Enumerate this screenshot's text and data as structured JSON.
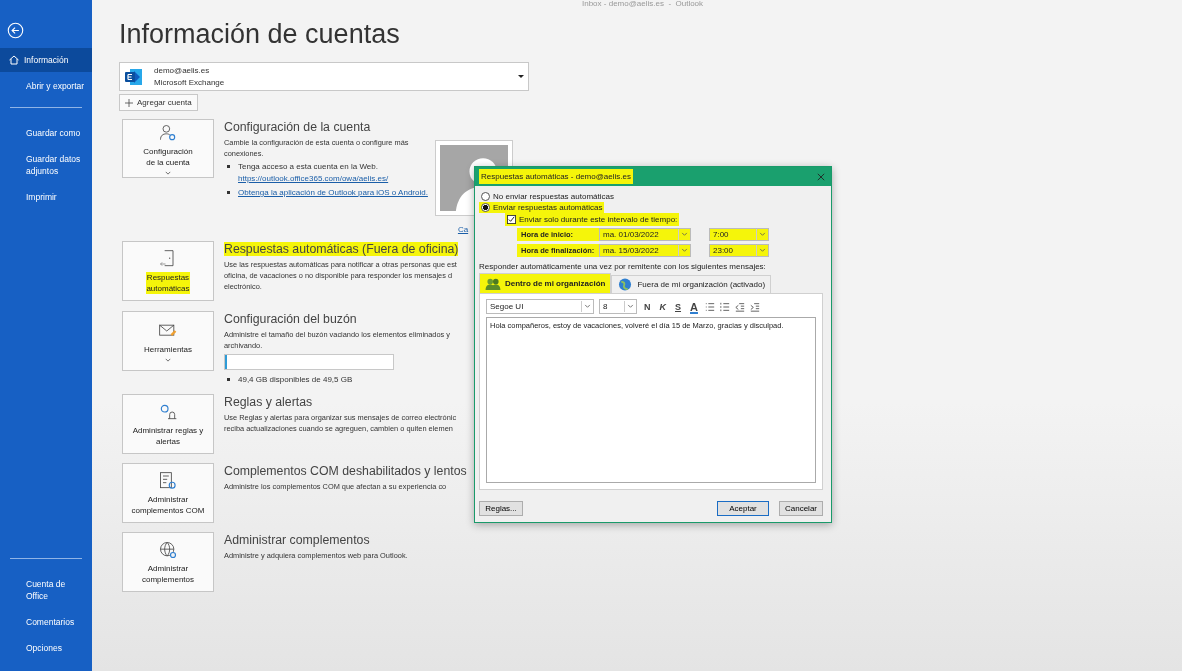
{
  "window": {
    "title": "Inbox - demo@aelis.es  -  Outlook"
  },
  "sidebar": {
    "groups": [
      [
        {
          "label": "Información",
          "selected": true
        },
        {
          "label": "Abrir y exportar",
          "selected": false
        }
      ],
      [
        {
          "label": "Guardar como",
          "selected": false
        },
        {
          "label": "Guardar datos adjuntos",
          "selected": false
        },
        {
          "label": "Imprimir",
          "selected": false
        }
      ],
      [
        {
          "label": "Cuenta de Office",
          "selected": false
        },
        {
          "label": "Comentarios",
          "selected": false
        },
        {
          "label": "Opciones",
          "selected": false
        }
      ]
    ]
  },
  "page_title": "Información de cuentas",
  "account": {
    "email": "demo@aelis.es",
    "type": "Microsoft Exchange"
  },
  "add_account_button": "Agregar cuenta",
  "sections": [
    {
      "kind": "account",
      "tile_lines": [
        "Configuración",
        "de la cuenta"
      ],
      "dropdown": true,
      "heading": "Configuración de la cuenta",
      "description_lines": [
        "Cambie la configuración de esta cuenta o configure más",
        "conexiones."
      ],
      "bullets": [
        {
          "text": "Tenga acceso a esta cuenta en la Web.",
          "link": "https://outlook.office365.com/owa/aelis.es/"
        },
        {
          "link": "Obtenga la aplicación de Outlook para iOS o Android."
        }
      ],
      "photo_link": "Ca"
    },
    {
      "kind": "auto_reply",
      "tile_lines": [
        "Respuestas",
        "automáticas"
      ],
      "tile_highlighted": true,
      "heading": "Respuestas automáticas (Fuera de oficina)",
      "highlighted": true,
      "description_lines": [
        "Use las respuestas automáticas para notificar a otras personas que est",
        "oficina, de vacaciones o no disponible para responder los mensajes d",
        "electrónico."
      ]
    },
    {
      "kind": "mailbox",
      "tile_lines": [
        "Herramientas"
      ],
      "dropdown": true,
      "heading": "Configuración del buzón",
      "description_lines": [
        "Administre el tamaño del buzón vaciando los elementos eliminados y",
        "archivando."
      ],
      "storage": {
        "level": 0.01,
        "text": "49,4 GB disponibles de 49,5 GB"
      }
    },
    {
      "kind": "rules",
      "tile_lines": [
        "Administrar reglas y",
        "alertas"
      ],
      "heading": "Reglas y alertas",
      "description_lines": [
        "Use Reglas y alertas para organizar sus mensajes de correo electrónic",
        "reciba actualizaciones cuando se agreguen, cambien o quiten elemen"
      ]
    },
    {
      "kind": "com",
      "tile_lines": [
        "Administrar",
        "complementos COM"
      ],
      "heading": "Complementos COM deshabilitados y lentos",
      "description_lines": [
        "Administre los complementos COM que afectan a su experiencia co"
      ]
    },
    {
      "kind": "addins",
      "tile_lines": [
        "Administrar",
        "complementos"
      ],
      "heading": "Administrar complementos",
      "description_lines": [
        "Administre y adquiera complementos web para Outlook."
      ]
    }
  ],
  "dialog": {
    "title": "Respuestas automáticas - demo@aelis.es",
    "title_highlighted": true,
    "options": [
      {
        "label": "No enviar respuestas automáticas",
        "selected": false
      },
      {
        "label": "Enviar respuestas automáticas",
        "selected": true,
        "highlighted": true
      }
    ],
    "interval": {
      "label": "Enviar solo durante este intervalo de tiempo:",
      "checked": true,
      "highlighted": true,
      "rows": [
        {
          "label": "Hora de inicio:",
          "date": "ma. 01/03/2022",
          "time": "7:00"
        },
        {
          "label": "Hora de finalización:",
          "date": "ma. 15/03/2022",
          "time": "23:00"
        }
      ]
    },
    "prompt": "Responder automáticamente una vez por remitente con los siguientes mensajes:",
    "tabs": [
      {
        "label": "Dentro de mi organización",
        "selected": true,
        "highlighted": true
      },
      {
        "label": "Fuera de mi organización (activado)",
        "selected": false
      }
    ],
    "font": "Segoe UI",
    "size": "8",
    "format_buttons": [
      "N",
      "K",
      "S",
      "A"
    ],
    "message": "Hola compañeros, estoy de vacaciones, volveré el día 15 de Marzo, gracias y disculpad.",
    "buttons": [
      {
        "label": "Reglas...",
        "kind": "normal"
      },
      {
        "label": "Aceptar",
        "kind": "default"
      },
      {
        "label": "Cancelar",
        "kind": "normal"
      }
    ]
  }
}
